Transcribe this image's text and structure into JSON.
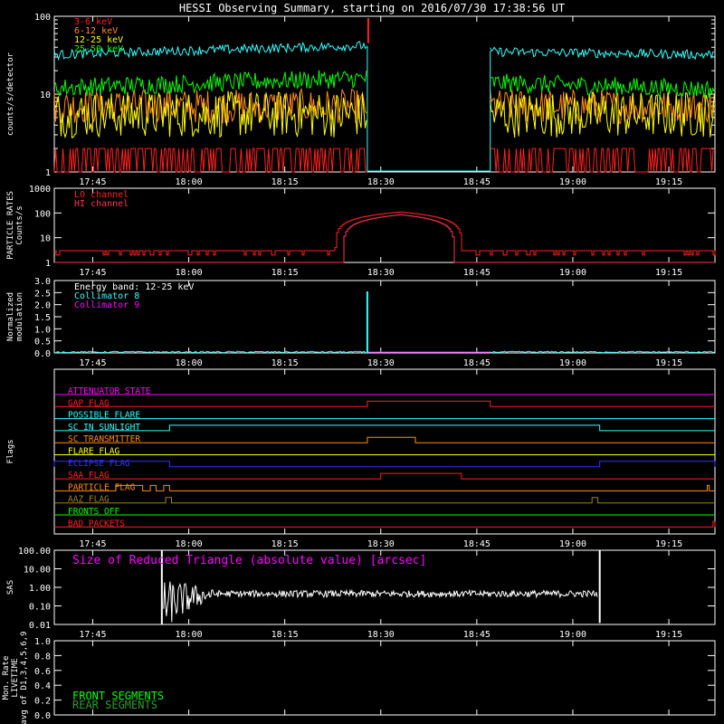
{
  "title": "HESSI Observing Summary, starting on 2016/07/30 17:38:56 UT",
  "x_ticks": [
    "17:45",
    "18:00",
    "18:15",
    "18:30",
    "18:45",
    "19:00",
    "19:15"
  ],
  "colors": {
    "red": "#ff2020",
    "orange": "#ff8c1a",
    "yellow": "#ffff00",
    "green": "#00ff00",
    "cyan": "#33ffff",
    "magenta": "#ff00ff",
    "blue": "#3333ff",
    "white": "#ffffff",
    "olive": "#a08020",
    "darkgreen": "#2e9b2e"
  },
  "chart_data": [
    {
      "type": "line",
      "name": "counts",
      "ylabel": "counts/s/detector",
      "y_scale": "log",
      "ylim": [
        1,
        100
      ],
      "y_ticks": [
        "1",
        "10",
        "100"
      ],
      "legend": [
        "3-6 keV",
        "6-12 keV",
        "12-25 keV",
        "25-50 keV"
      ],
      "series": [
        {
          "name": "3-6 keV",
          "color": "red",
          "segments": [
            {
              "x": [
                17.65,
                18.465
              ],
              "y": 2.0
            },
            {
              "x": [
                18.785,
                19.37
              ],
              "y": 2.0
            }
          ]
        },
        {
          "name": "6-12 keV",
          "color": "orange",
          "segments": [
            {
              "x": [
                17.65,
                18.465
              ],
              "y": 7.0
            },
            {
              "x": [
                18.785,
                19.37
              ],
              "y": 7.0
            }
          ]
        },
        {
          "name": "12-25 keV",
          "color": "yellow",
          "segments": [
            {
              "x": [
                17.65,
                18.465
              ],
              "y": 5.5
            },
            {
              "x": [
                18.785,
                19.37
              ],
              "y": 5.5
            }
          ]
        },
        {
          "name": "25-50 keV",
          "color": "green",
          "segments": [
            {
              "x": [
                17.65,
                18.465
              ],
              "y": [
                12,
                16
              ]
            },
            {
              "x": [
                18.785,
                19.37
              ],
              "y": [
                14,
                11.5
              ]
            }
          ]
        },
        {
          "name": "cyan",
          "color": "cyan",
          "segments": [
            {
              "x": [
                17.65,
                18.465
              ],
              "y": [
                32,
                42
              ]
            },
            {
              "x": [
                18.465,
                18.785
              ],
              "y": 1.0
            },
            {
              "x": [
                18.785,
                19.37
              ],
              "y": [
                35,
                32
              ]
            }
          ]
        }
      ],
      "spike": {
        "x": 18.465,
        "y": 95,
        "color": "red"
      }
    },
    {
      "type": "line",
      "name": "particle_rates",
      "ylabel": "PARTICLE RATES Counts/s",
      "y_scale": "log",
      "ylim": [
        1,
        1000
      ],
      "y_ticks": [
        "1",
        "10",
        "100",
        "1000"
      ],
      "legend": [
        "LO channel",
        "HI channel"
      ],
      "series": [
        {
          "name": "LO channel",
          "color": "red",
          "baseline": 3,
          "hump": {
            "start": 18.38,
            "peak": 18.55,
            "end": 18.71,
            "max": 110
          }
        },
        {
          "name": "HI channel",
          "color": "red",
          "baseline": 1,
          "hump": {
            "start": 18.4,
            "peak": 18.55,
            "end": 18.69,
            "max": 85
          }
        }
      ]
    },
    {
      "type": "line",
      "name": "modulation",
      "ylabel": "Normalized modulation",
      "ylim": [
        0,
        3.0
      ],
      "y_ticks": [
        "0.0",
        "0.5",
        "1.0",
        "1.5",
        "2.0",
        "2.5",
        "3.0"
      ],
      "legend": [
        "Energy band: 12-25 keV",
        "Collimator 8",
        "Collimator 9"
      ],
      "series": [
        {
          "name": "Collimator 8",
          "color": "cyan",
          "segments": [
            {
              "x": [
                17.65,
                18.465
              ],
              "y": 0.05
            },
            {
              "x": [
                18.785,
                19.37
              ],
              "y": 0.05
            }
          ]
        },
        {
          "name": "Collimator 9",
          "color": "magenta",
          "segments": [
            {
              "x": [
                18.465,
                18.785
              ],
              "y": 0.0
            }
          ]
        }
      ],
      "spike": {
        "x": 18.465,
        "y": 2.55,
        "color": "cyan"
      }
    },
    {
      "type": "line",
      "name": "flags",
      "ylabel": "Flags",
      "flags": [
        {
          "label": "ATTENUATOR STATE",
          "color": "magenta",
          "high": []
        },
        {
          "label": "GAP FLAG",
          "color": "red",
          "high": [
            [
              18.465,
              18.785
            ]
          ]
        },
        {
          "label": "POSSIBLE FLARE",
          "color": "cyan",
          "high": []
        },
        {
          "label": "SC IN SUNLIGHT",
          "color": "cyan",
          "high": [
            [
              17.95,
              19.07
            ]
          ]
        },
        {
          "label": "SC TRANSMITTER",
          "color": "orange",
          "high": [
            [
              18.465,
              18.59
            ]
          ]
        },
        {
          "label": "FLARE FLAG",
          "color": "yellow",
          "high": []
        },
        {
          "label": "ECLIPSE FLAG",
          "color": "blue",
          "high": [
            [
              17.65,
              17.95
            ],
            [
              19.07,
              19.37
            ]
          ]
        },
        {
          "label": "SAA FLAG",
          "color": "red",
          "high": [
            [
              18.5,
              18.71
            ]
          ]
        },
        {
          "label": "PARTICLE FLAG",
          "color": "orange",
          "high": [
            [
              17.81,
              17.88
            ],
            [
              17.9,
              17.915
            ],
            [
              17.935,
              17.95
            ],
            [
              19.35,
              19.355
            ]
          ]
        },
        {
          "label": "AAZ FLAG",
          "color": "olive",
          "high": [
            [
              17.94,
              17.955
            ],
            [
              19.05,
              19.065
            ]
          ]
        },
        {
          "label": "FRONTS OFF",
          "color": "green",
          "high": []
        },
        {
          "label": "BAD PACKETS",
          "color": "red",
          "high": [
            [
              19.365,
              19.37
            ]
          ]
        }
      ]
    },
    {
      "type": "line",
      "name": "sas",
      "ylabel": "SAS",
      "y_scale": "log",
      "ylim": [
        0.01,
        100
      ],
      "y_ticks": [
        "0.01",
        "0.10",
        "1.00",
        "10.00",
        "100.00"
      ],
      "legend": [
        "Size of Reduced Triangle (absolute value) [arcsec]"
      ],
      "series": [
        {
          "name": "Size of Reduced Triangle (absolute value) [arcsec]",
          "color": "white",
          "x_range": [
            17.93,
            19.07
          ],
          "level": 0.45
        }
      ]
    },
    {
      "type": "line",
      "name": "livetime",
      "ylabel": "Mon. Rate LIVETIME avg of D1,3,4,5,6,9",
      "ylim": [
        0,
        1.0
      ],
      "y_ticks": [
        "0.0",
        "0.2",
        "0.4",
        "0.6",
        "0.8",
        "1.0"
      ],
      "legend": [
        "FRONT SEGMENTS",
        "REAR SEGMENTS"
      ]
    }
  ]
}
